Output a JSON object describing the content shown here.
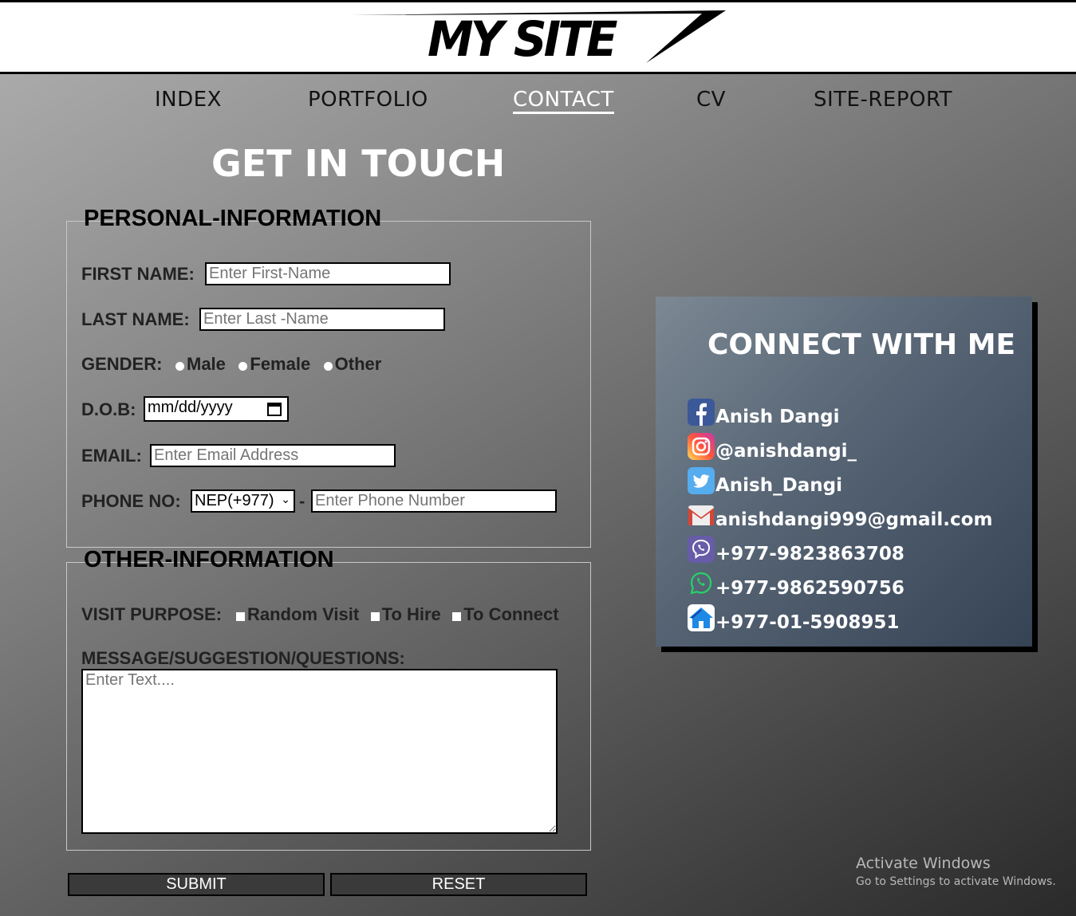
{
  "header": {
    "logo_text": "MY SITE"
  },
  "nav": {
    "items": [
      "INDEX",
      "PORTFOLIO",
      "CONTACT",
      "CV",
      "SITE-REPORT"
    ],
    "active": "CONTACT"
  },
  "page_title": "GET IN TOUCH",
  "personal": {
    "legend": "PERSONAL-INFORMATION",
    "first_name_label": "FIRST NAME:",
    "first_name_placeholder": "Enter First-Name",
    "last_name_label": "LAST NAME:",
    "last_name_placeholder": "Enter Last -Name",
    "gender_label": "GENDER:",
    "gender_options": [
      "Male",
      "Female",
      "Other"
    ],
    "dob_label": "D.O.B:",
    "dob_placeholder": "mm/dd/yyyy",
    "email_label": "EMAIL:",
    "email_placeholder": "Enter Email Address",
    "phone_label": "PHONE NO:",
    "phone_code": "NEP(+977)",
    "phone_sep": "-",
    "phone_placeholder": "Enter Phone Number"
  },
  "other": {
    "legend": "OTHER-INFORMATION",
    "purpose_label": "VISIT PURPOSE:",
    "purpose_options": [
      "Random Visit",
      "To Hire",
      "To Connect"
    ],
    "message_label": "MESSAGE/SUGGESTION/QUESTIONS:",
    "message_placeholder": "Enter Text...."
  },
  "buttons": {
    "submit": "SUBMIT",
    "reset": "RESET"
  },
  "connect": {
    "title": "CONNECT WITH ME",
    "items": [
      {
        "icon": "facebook-icon",
        "text": "Anish Dangi"
      },
      {
        "icon": "instagram-icon",
        "text": "@anishdangi_"
      },
      {
        "icon": "twitter-icon",
        "text": "Anish_Dangi"
      },
      {
        "icon": "gmail-icon",
        "text": "anishdangi999@gmail.com"
      },
      {
        "icon": "viber-icon",
        "text": "+977-9823863708"
      },
      {
        "icon": "whatsapp-icon",
        "text": "+977-9862590756"
      },
      {
        "icon": "home-icon",
        "text": "+977-01-5908951"
      }
    ]
  },
  "watermark": {
    "line1": "Activate Windows",
    "line2": "Go to Settings to activate Windows."
  },
  "colors": {
    "facebook": "#3b5998",
    "twitter": "#55acee",
    "gmail": "#d44638",
    "viber": "#665ca7",
    "whatsapp": "#25d366",
    "home": "#1e88e5"
  }
}
